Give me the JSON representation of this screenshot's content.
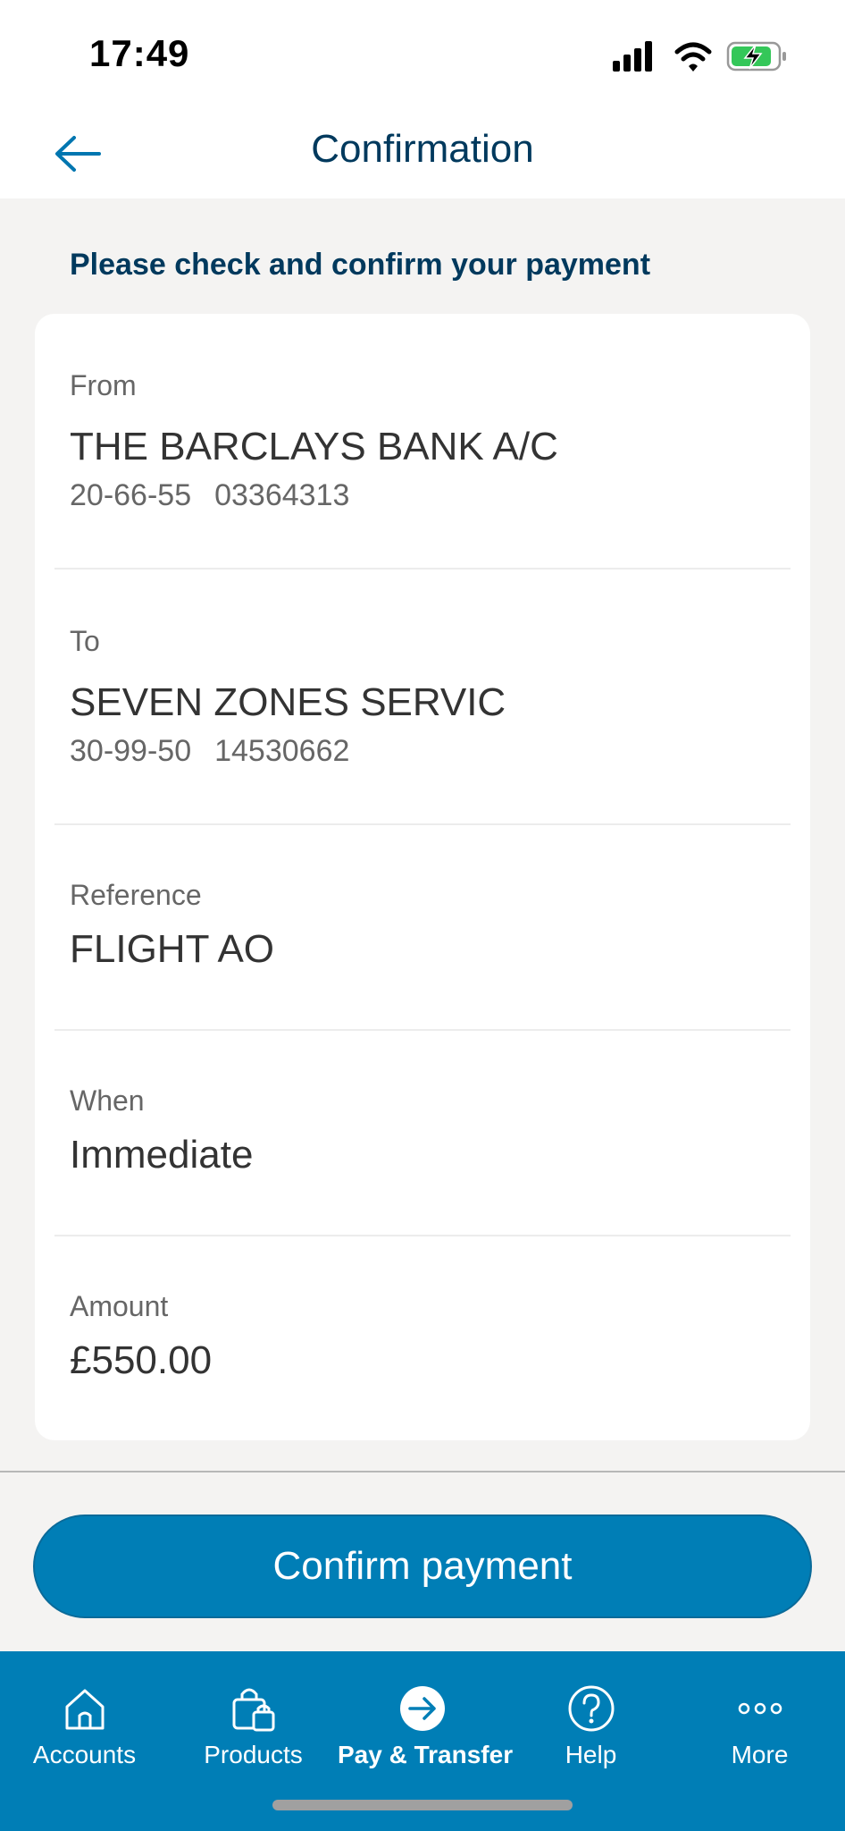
{
  "status_bar": {
    "time": "17:49"
  },
  "header": {
    "title": "Confirmation",
    "back_icon": "arrow-left-icon"
  },
  "instruction": "Please check and confirm your payment",
  "details": {
    "from": {
      "label": "From",
      "name": "THE BARCLAYS BANK A/C",
      "sort_code": "20-66-55",
      "account_number": "03364313"
    },
    "to": {
      "label": "To",
      "name": "SEVEN ZONES SERVIC",
      "sort_code": "30-99-50",
      "account_number": "14530662"
    },
    "reference": {
      "label": "Reference",
      "value": "FLIGHT AO"
    },
    "when": {
      "label": "When",
      "value": "Immediate"
    },
    "amount": {
      "label": "Amount",
      "value": "£550.00"
    }
  },
  "confirm_button": {
    "label": "Confirm payment"
  },
  "tabbar": {
    "items": [
      {
        "label": "Accounts",
        "icon": "home-icon"
      },
      {
        "label": "Products",
        "icon": "shopping-bag-icon"
      },
      {
        "label": "Pay & Transfer",
        "icon": "arrow-right-circle-icon",
        "active": true
      },
      {
        "label": "Help",
        "icon": "question-circle-icon"
      },
      {
        "label": "More",
        "icon": "more-dots-icon"
      }
    ]
  },
  "colors": {
    "brand_blue": "#007eb6",
    "navy": "#00395d",
    "background": "#f4f3f2"
  }
}
